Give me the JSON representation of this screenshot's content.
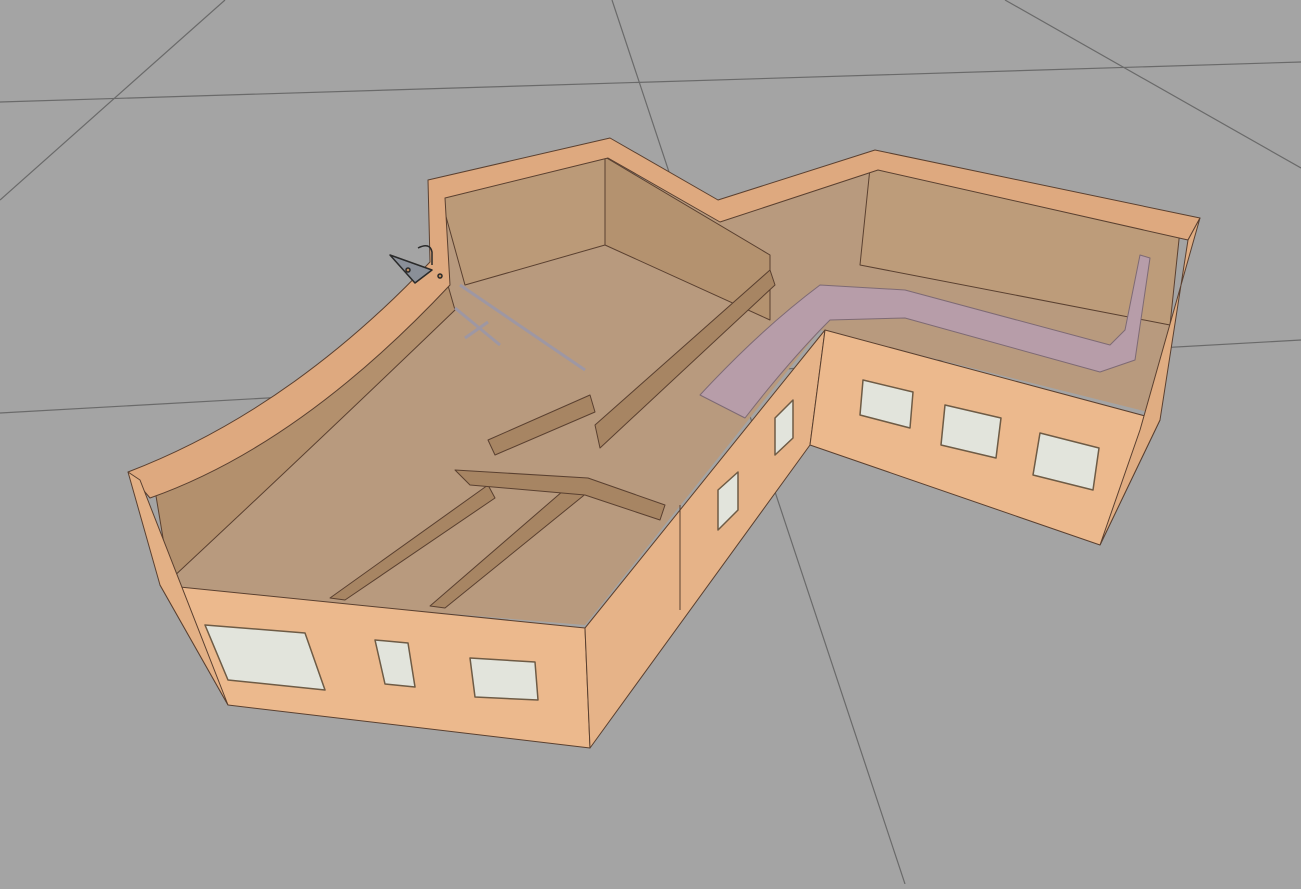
{
  "viewport": {
    "background_color": "#a4a4a4",
    "grid_line_color": "#6a6a6a"
  },
  "model": {
    "wall_exterior_color": "#ecb98d",
    "wall_top_color": "#dea97f",
    "wall_interior_color": "#b79572",
    "floor_color": "#b89a7e",
    "stair_color": "#b79da9",
    "window_glass_color": "#e2e4dc"
  },
  "icons": {
    "camera_gizmo": "camera-gizmo-icon"
  }
}
